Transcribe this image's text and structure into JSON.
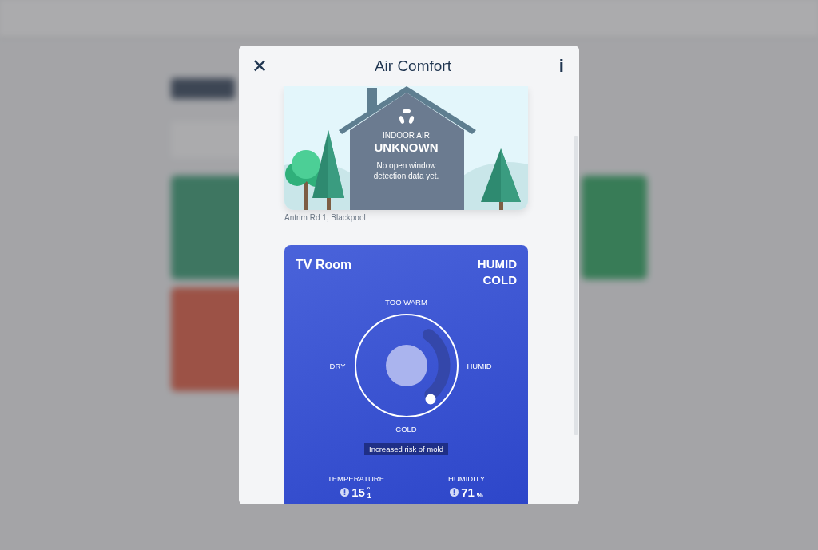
{
  "dialog": {
    "title": "Air Comfort",
    "close_icon": "✕",
    "info_icon": "i"
  },
  "air_card": {
    "label": "INDOOR AIR",
    "status": "UNKNOWN",
    "message": "No open window detection data yet.",
    "address": "Antrim Rd 1, Blackpool"
  },
  "room_card": {
    "name": "TV Room",
    "states": [
      "HUMID",
      "COLD"
    ],
    "dial": {
      "top": "TOO WARM",
      "left": "DRY",
      "right": "HUMID",
      "bottom": "COLD"
    },
    "note": "Increased risk of mold",
    "metrics": [
      {
        "label": "TEMPERATURE",
        "value": "15",
        "unit": "°",
        "fraction": "1"
      },
      {
        "label": "HUMIDITY",
        "value": "71",
        "unit": "%"
      }
    ]
  }
}
